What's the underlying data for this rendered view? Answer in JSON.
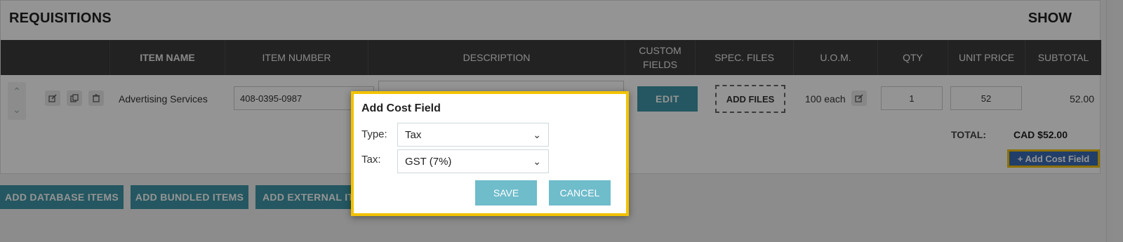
{
  "header": {
    "title": "REQUISITIONS",
    "show_label": "SHOW"
  },
  "columns": [
    "ITEM NAME",
    "ITEM NUMBER",
    "DESCRIPTION",
    "CUSTOM\nFIELDS",
    "SPEC. FILES",
    "U.O.M.",
    "QTY",
    "UNIT PRICE",
    "SUBTOTAL"
  ],
  "row": {
    "item_name": "Advertising Services",
    "item_number": "408-0395-0987",
    "edit_label": "EDIT",
    "add_files_label": "ADD FILES",
    "uom": "100 each",
    "qty": "1",
    "unit_price": "52",
    "subtotal": "52.00"
  },
  "totals": {
    "label": "TOTAL:",
    "value": "CAD $52.00"
  },
  "add_cost_field_button": "+ Add Cost Field",
  "bottom_buttons": [
    "ADD DATABASE ITEMS",
    "ADD BUNDLED ITEMS",
    "ADD EXTERNAL IT"
  ],
  "modal": {
    "title": "Add Cost Field",
    "type_label": "Type:",
    "type_value": "Tax",
    "tax_label": "Tax:",
    "tax_value": "GST (7%)",
    "save_label": "SAVE",
    "cancel_label": "CANCEL"
  },
  "colors": {
    "accent": "#3f96a7",
    "highlight": "#f2c200",
    "header_bg": "#3c3c3c"
  }
}
